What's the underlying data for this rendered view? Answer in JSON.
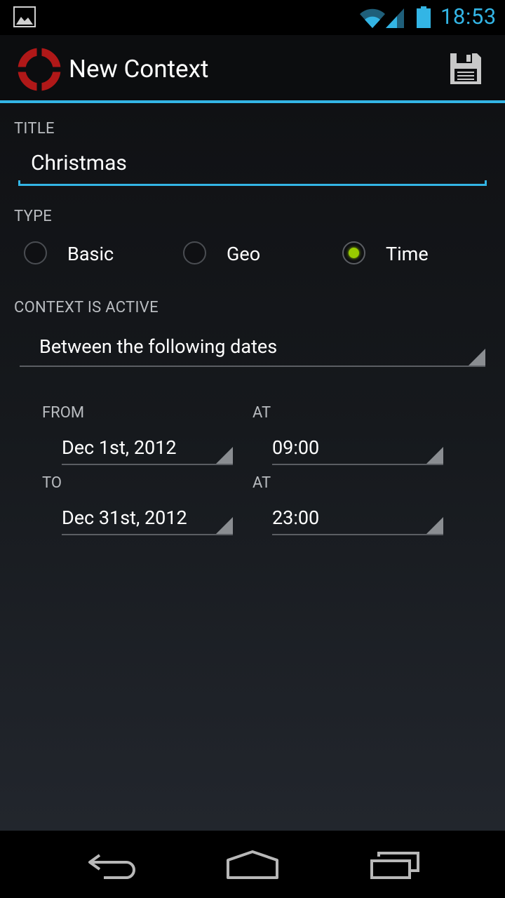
{
  "status_bar": {
    "time": "18:53",
    "icons": [
      "image-notification-icon",
      "wifi-icon",
      "signal-icon",
      "battery-icon"
    ]
  },
  "action_bar": {
    "title": "New Context",
    "icons": [
      "app-lifebuoy-icon",
      "save-floppy-icon"
    ]
  },
  "form": {
    "title_label": "TITLE",
    "title_value": "Christmas",
    "type_label": "TYPE",
    "type_options": [
      {
        "label": "Basic",
        "checked": false
      },
      {
        "label": "Geo",
        "checked": false
      },
      {
        "label": "Time",
        "checked": true
      }
    ],
    "active_label": "CONTEXT IS ACTIVE",
    "active_value": "Between the following dates",
    "from_label": "FROM",
    "from_at_label": "AT",
    "from_date": "Dec 1st, 2012",
    "from_time": "09:00",
    "to_label": "TO",
    "to_at_label": "AT",
    "to_date": "Dec 31st, 2012",
    "to_time": "23:00"
  },
  "nav_bar": {
    "icons": [
      "back-icon",
      "home-icon",
      "recent-apps-icon"
    ]
  },
  "colors": {
    "accent": "#33b5e5",
    "radio_checked": "#99cc00",
    "app_icon_red": "#b01818"
  }
}
